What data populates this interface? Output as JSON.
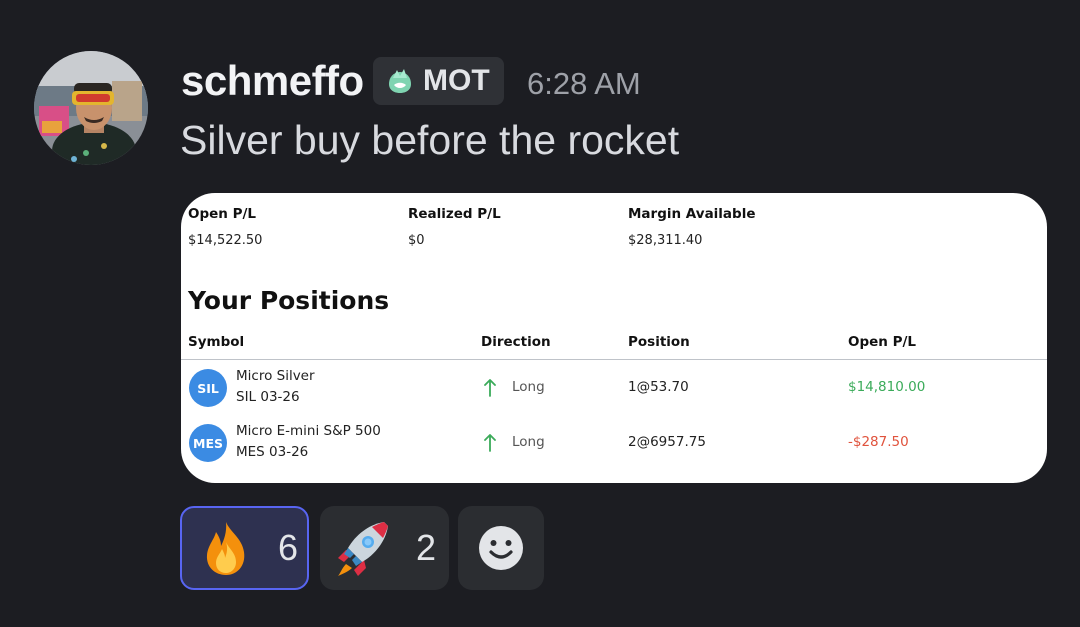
{
  "message": {
    "author": "schmeffo",
    "role_tag": "MOT",
    "timestamp": "6:28 AM",
    "text": "Silver buy before the rocket"
  },
  "card": {
    "summary": [
      {
        "label": "Open P/L",
        "value": "$14,522.50"
      },
      {
        "label": "Realized P/L",
        "value": "$0"
      },
      {
        "label": "Margin Available",
        "value": "$28,311.40"
      }
    ],
    "positions_title": "Your Positions",
    "columns": [
      "Symbol",
      "Direction",
      "Position",
      "Open P/L"
    ],
    "rows": [
      {
        "badge": "SIL",
        "name": "Micro Silver",
        "code": "SIL 03-26",
        "direction": "Long",
        "position": "1@53.70",
        "open_pl": "$14,810.00",
        "pl_color": "#3bab5a"
      },
      {
        "badge": "MES",
        "name": "Micro E-mini S&P 500",
        "code": "MES 03-26",
        "direction": "Long",
        "position": "2@6957.75",
        "open_pl": "-$287.50",
        "pl_color": "#e0533d"
      }
    ]
  },
  "reactions": [
    {
      "emoji": "fire-icon",
      "count": "6",
      "active": true
    },
    {
      "emoji": "rocket-icon",
      "count": "2",
      "active": false
    },
    {
      "emoji": "add-reaction-icon",
      "count": "",
      "active": false
    }
  ],
  "colors": {
    "background": "#1c1d22",
    "accent": "#5865f2",
    "badge_blue": "#3b8be3",
    "gain_green": "#3bab5a",
    "loss_red": "#e0533d"
  }
}
